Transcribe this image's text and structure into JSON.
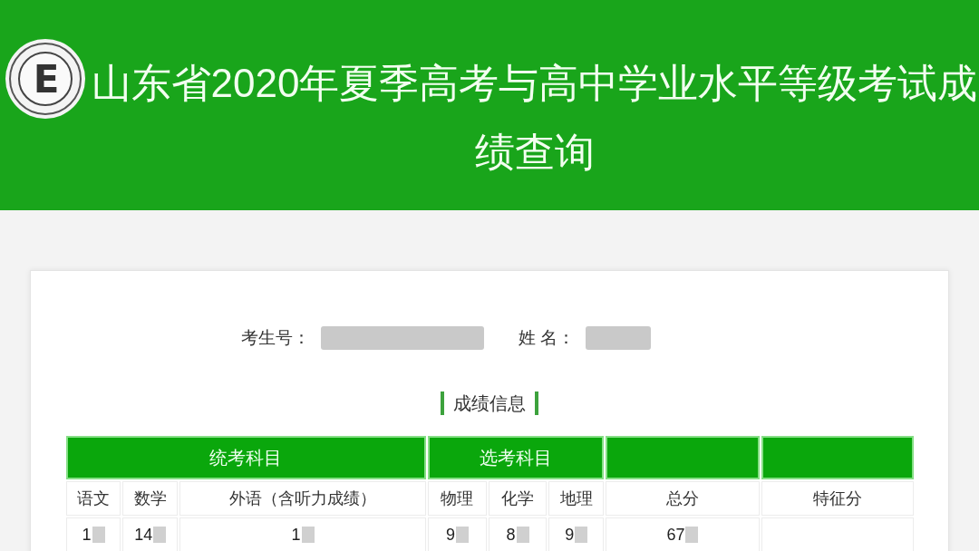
{
  "header": {
    "logo_letter": "E",
    "title": "山东省2020年夏季高考与高中学业水平等级考试成绩查询"
  },
  "candidate": [
    {
      "label": "考生号：",
      "redacted": true
    },
    {
      "label": "姓 名：",
      "redacted": true
    }
  ],
  "section_title": "成绩信息",
  "table": {
    "groups": [
      {
        "label": "统考科目",
        "columns": [
          "语文",
          "数学",
          "外语（含听力成绩）"
        ]
      },
      {
        "label": "选考科目",
        "columns": [
          "物理",
          "化学",
          "地理"
        ]
      },
      {
        "columns": [
          "总分"
        ]
      },
      {
        "columns": [
          "特征分"
        ]
      }
    ],
    "rows": [
      {
        "cells": [
          {
            "text": "1",
            "redacted": true
          },
          {
            "text": "14",
            "redacted": true
          },
          {
            "text": "1",
            "redacted": true
          },
          {
            "text": "9",
            "redacted": true
          },
          {
            "text": "8",
            "redacted": true
          },
          {
            "text": "9",
            "redacted": true
          },
          {
            "text": "67",
            "redacted": true
          }
        ]
      }
    ]
  }
}
